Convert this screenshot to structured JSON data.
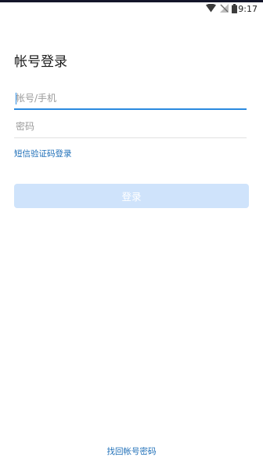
{
  "status_bar": {
    "time": "9:17",
    "icons": [
      "wifi-icon",
      "no-signal-icon",
      "battery-icon"
    ]
  },
  "login": {
    "title": "帐号登录",
    "account_placeholder": "帐号/手机",
    "account_value": "",
    "password_placeholder": "密码",
    "password_value": "",
    "sms_login_link": "短信验证码登录",
    "login_button": "登录",
    "login_button_enabled": false,
    "recover_password_link": "找回帐号密码"
  },
  "colors": {
    "accent": "#2b8ae0",
    "link": "#1f6fb8",
    "button_disabled": "#cfe3fb",
    "status_bar_top": "#14162a"
  }
}
